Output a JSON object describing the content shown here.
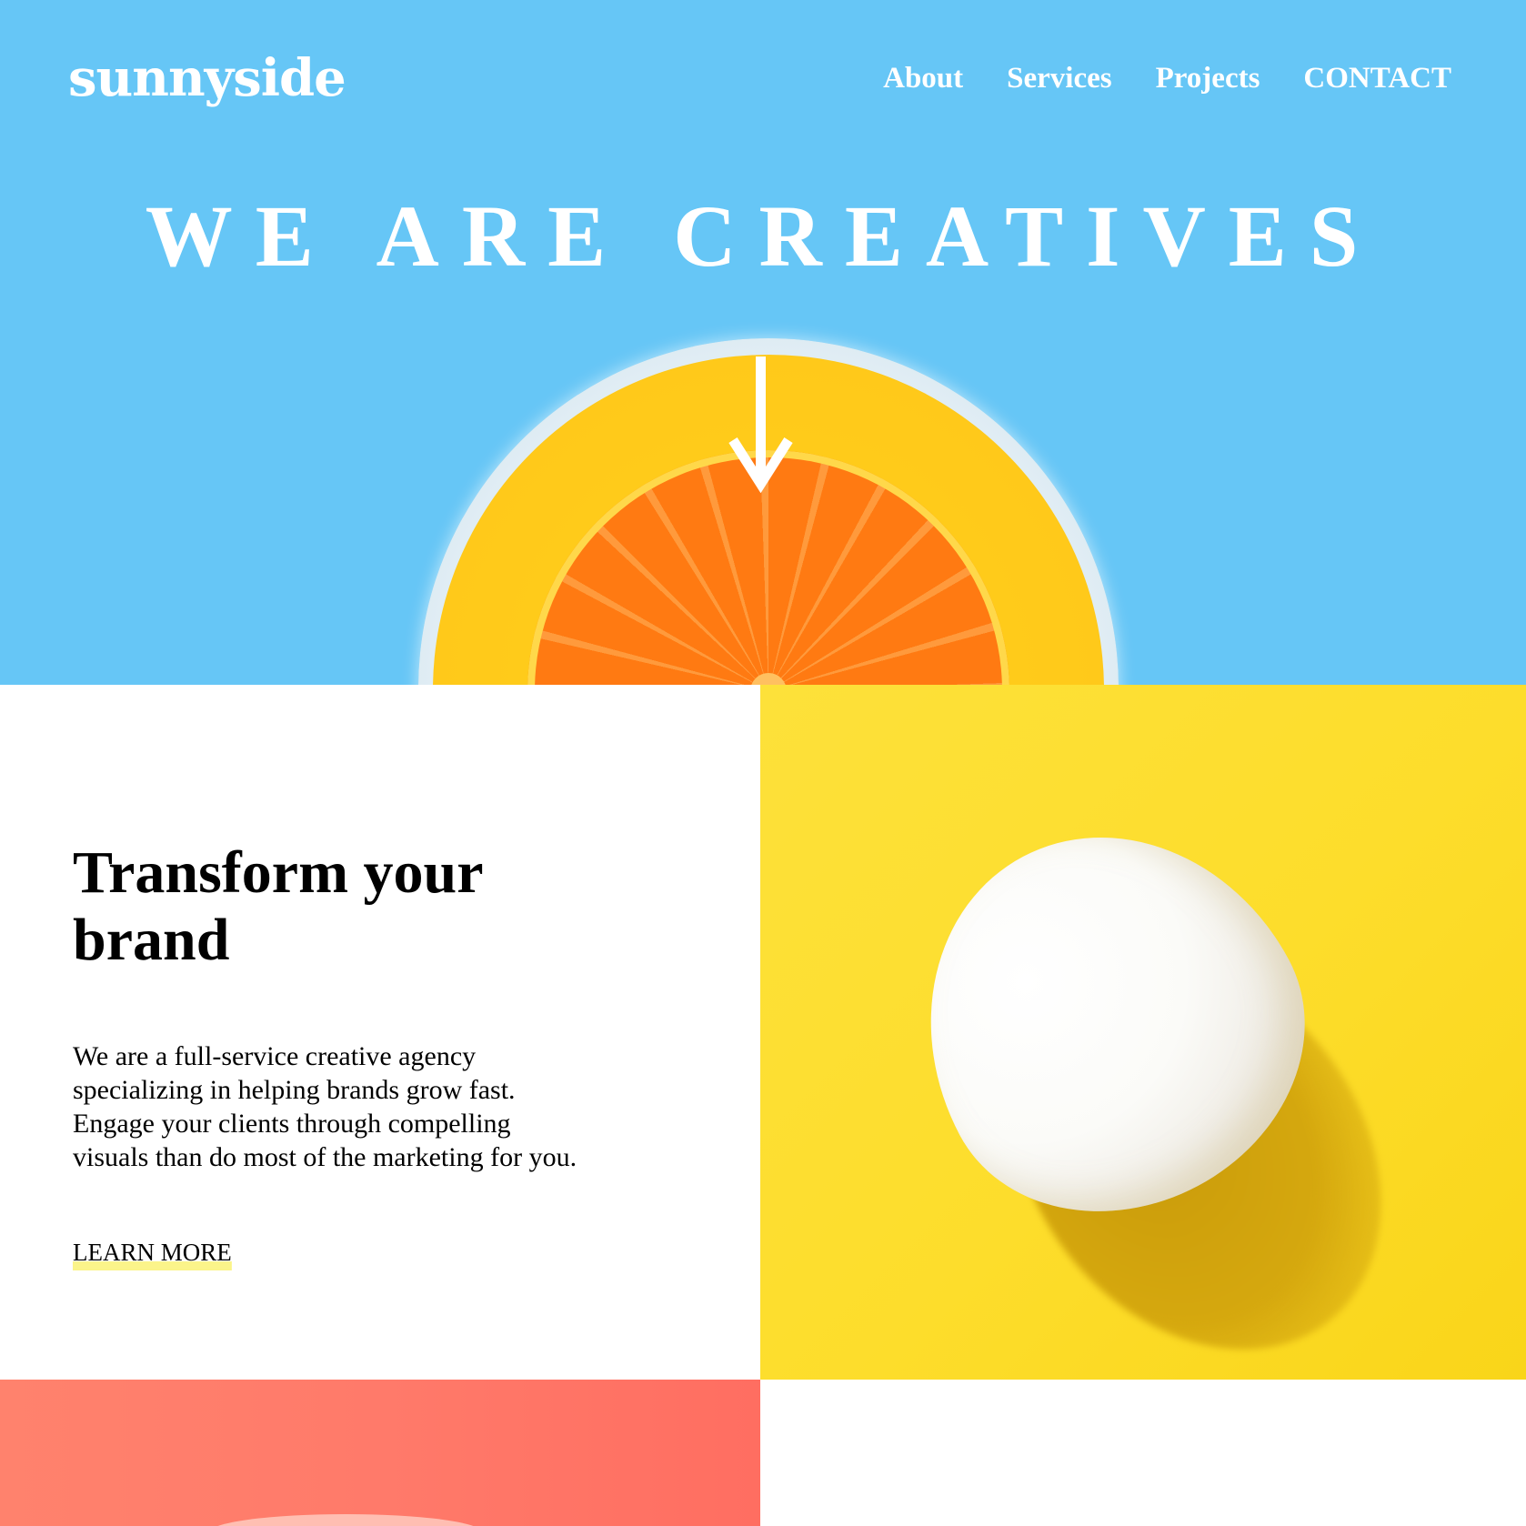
{
  "header": {
    "logo": "sunnyside",
    "nav": [
      {
        "label": "About"
      },
      {
        "label": "Services"
      },
      {
        "label": "Projects"
      },
      {
        "label": "CONTACT"
      }
    ]
  },
  "hero": {
    "title": "WE ARE CREATIVES",
    "scroll_icon": "arrow-down-icon"
  },
  "transform": {
    "heading": "Transform your brand",
    "body": "We are a full-service creative agency specializing in helping brands grow fast. Engage your clients through compelling visuals than do most of the marketing for you.",
    "cta": "LEARN MORE"
  },
  "colors": {
    "hero_bg": "#66c6f6",
    "egg_bg": "#fddd2b",
    "cta_underline": "#fbf48a",
    "bottom_left_bg": "#ff7a6a"
  }
}
